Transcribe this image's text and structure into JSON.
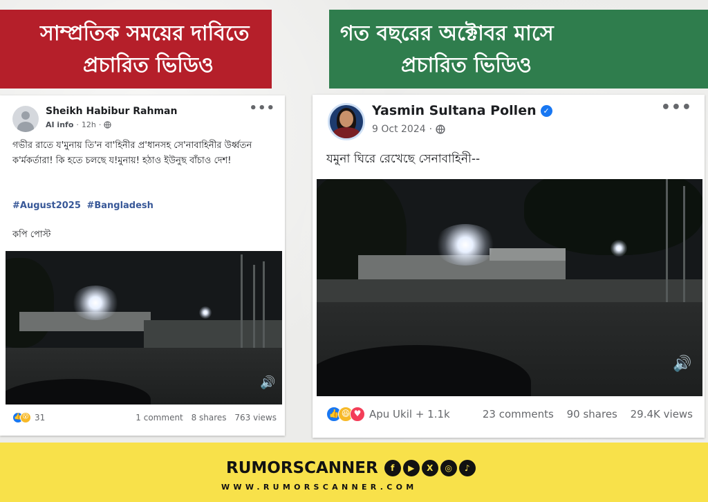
{
  "banners": {
    "left": {
      "line1": "সাম্প্রতিক সময়ের দাবিতে",
      "line2": "প্রচারিত ভিডিও"
    },
    "right": {
      "line1": "গত বছরের অক্টোবর মাসে",
      "line2": "প্রচারিত ভিডিও"
    }
  },
  "left_post": {
    "author": "Sheikh Habibur Rahman",
    "meta_ai": "AI info",
    "meta_sep": "·",
    "meta_time": "12h",
    "meta_sep2": "·",
    "privacy_icon": "globe-icon",
    "more": "•••",
    "text": "গভীর রাতে য'মুনায় তি'ন বা'হিনীর প্র'ধানসহ সে'নাবাহিনীর উর্ধ্বতন ক'র্মকর্তারা! কি হতে চলছে য!মুনায়! হঠাও ইউনুছ বাঁচাও দেশ!",
    "hashtags": [
      "#August2025",
      "#Bangladesh"
    ],
    "copy_note": "কপি পোস্ট",
    "speaker": "🔊",
    "reaction_count": "31",
    "comments": "1 comment",
    "shares": "8 shares",
    "views": "763 views"
  },
  "right_post": {
    "author": "Yasmin Sultana Pollen",
    "verified": "✓",
    "date": "9 Oct 2024",
    "meta_sep": "·",
    "privacy_icon": "globe-icon",
    "more": "•••",
    "text": "যমুনা ঘিরে রেখেছে সেনাবাহিনী--",
    "speaker": "🔊",
    "reaction_names": "Apu Ukil + 1.1k",
    "comments": "23 comments",
    "shares": "90 shares",
    "views": "29.4K views"
  },
  "footer": {
    "brand": "RUMORSCANNER",
    "website": "WWW.RUMORSCANNER.COM",
    "socials": [
      "f",
      "▶",
      "X",
      "◎",
      "♪"
    ]
  },
  "colors": {
    "banner_red": "#b51f2a",
    "banner_green": "#2f7d4d",
    "footer_yellow": "#f8e14a",
    "facebook_blue": "#1877f2"
  }
}
